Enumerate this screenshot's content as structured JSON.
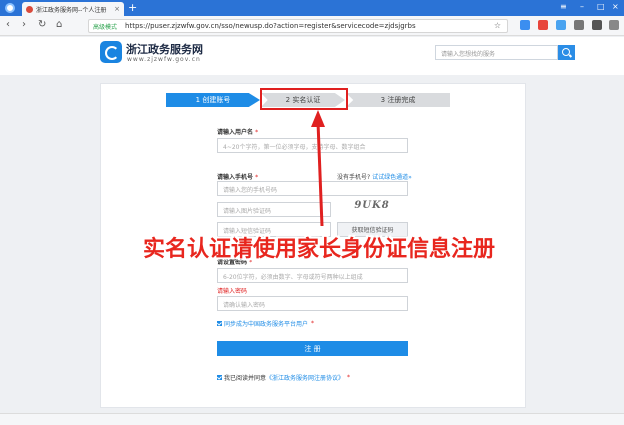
{
  "browser": {
    "tab_title": "浙江政务服务网--个人注册",
    "tab_close": "×",
    "new_tab": "+",
    "secure_label": "高级模式",
    "url": "https://puser.zjzwfw.gov.cn/sso/newusp.do?action=register&servicecode=zjdsjgrbs",
    "back": "‹",
    "forward": "›",
    "reload": "↻",
    "home": "⌂",
    "star": "☆"
  },
  "site": {
    "title": "浙江政务服务网",
    "subtitle": "www.zjzwfw.gov.cn",
    "search_placeholder": "请输入您想找的服务"
  },
  "steps": [
    {
      "label": "1 创建账号"
    },
    {
      "label": "2 实名认证"
    },
    {
      "label": "3 注册完成"
    }
  ],
  "form": {
    "username_label": "请输入用户名",
    "username_placeholder": "4~20个字符，第一位必须字母，支持字母、数字组合",
    "phone_label": "请输入手机号",
    "no_phone_text": "没有手机号?",
    "email_link": "试试绿色通道»",
    "phone_placeholder": "请输入您的手机号码",
    "captcha_placeholder": "请输入图片验证码",
    "captcha_text": "9UK8",
    "sms_placeholder": "请输入短信验证码",
    "sms_button": "获取短信验证码",
    "password_label": "请设置密码",
    "password_placeholder": "6-20位字符，必须由数字、字母或符号两种以上组成",
    "password_error": "请输入密码",
    "confirm_placeholder": "请确认输入密码",
    "sync_label": "同步成为中国政务服务平台用户",
    "submit_label": "注 册",
    "agree_prefix": "我已阅读并同意",
    "agree_link": "《浙江政务服务网注册协议》",
    "required_mark": "*"
  },
  "annotation": {
    "text": "实名认证请使用家长身份证信息注册",
    "color": "#e8261e"
  },
  "colors": {
    "accent": "#1e8ce6",
    "highlight": "#e02020",
    "tabbar": "#2b73d6"
  }
}
